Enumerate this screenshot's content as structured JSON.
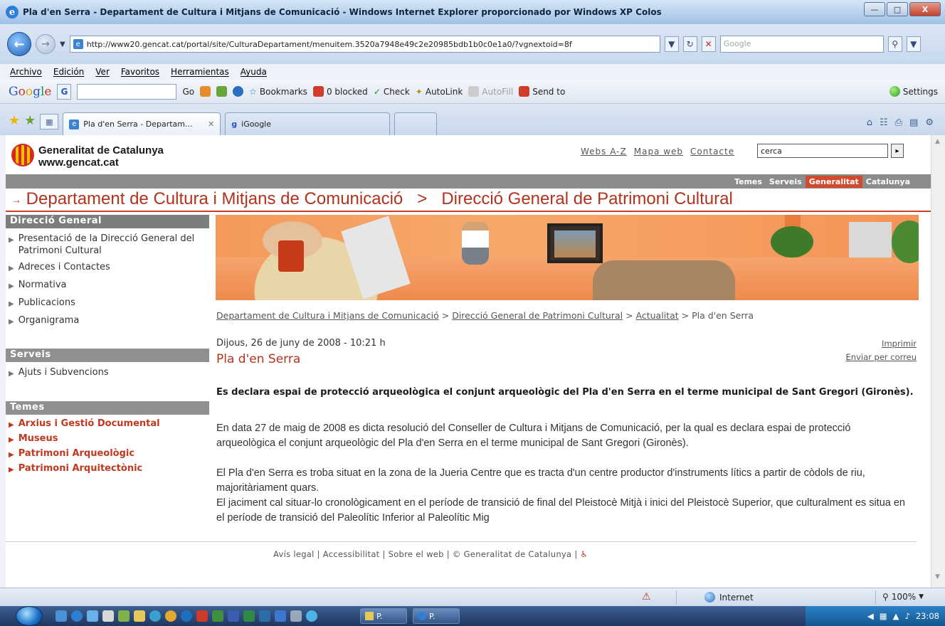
{
  "window": {
    "title": "Pla d'en Serra - Departament de Cultura i Mitjans de Comunicació - Windows Internet Explorer proporcionado por Windows XP Colos"
  },
  "address_bar": {
    "url": "http://www20.gencat.cat/portal/site/CulturaDepartament/menuitem.3520a7948e49c2e20985bdb1b0c0e1a0/?vgnextoid=8f",
    "search_placeholder": "Google"
  },
  "menu": [
    "Archivo",
    "Edición",
    "Ver",
    "Favoritos",
    "Herramientas",
    "Ayuda"
  ],
  "google_toolbar": {
    "go": "Go",
    "bookmarks": "Bookmarks",
    "blocked": "0 blocked",
    "check": "Check",
    "autolink": "AutoLink",
    "autofill": "AutoFill",
    "send_to": "Send to",
    "settings": "Settings"
  },
  "tabs": [
    {
      "label": "Pla d'en Serra - Departam..."
    },
    {
      "label": "iGoogle"
    }
  ],
  "site": {
    "org_name": "Generalitat de Catalunya",
    "org_url": "www.gencat.cat",
    "top_links": [
      "Webs A-Z",
      "Mapa web",
      "Contacte"
    ],
    "search_value": "cerca",
    "nav_tabs": [
      "Temes",
      "Serveis",
      "Generalitat",
      "Catalunya"
    ],
    "active_nav": "Generalitat",
    "dept_title": "Departament de Cultura i Mitjans de Comunicació",
    "dept_separator": ">",
    "sub_title": "Direcció General de Patrimoni Cultural"
  },
  "sidebar": {
    "section1": "Direcció General",
    "section1_items": [
      "Presentació de la Direcció General del Patrimoni Cultural",
      "Adreces i Contactes",
      "Normativa",
      "Publicacions",
      "Organigrama"
    ],
    "section2": "Serveis",
    "section2_items": [
      "Ajuts i Subvencions"
    ],
    "section3": "Temes",
    "section3_items": [
      "Arxius i Gestió Documental",
      "Museus",
      "Patrimoni Arqueològic",
      "Patrimoni Arquitectònic"
    ]
  },
  "breadcrumb": {
    "items": [
      "Departament de Cultura i Mitjans de Comunicació",
      "Direcció General de Patrimoni Cultural",
      "Actualitat"
    ],
    "current": "Pla d'en Serra",
    "separator": ">"
  },
  "article": {
    "date": "Dijous, 26 de juny de 2008 - 10:21 h",
    "title": "Pla d'en Serra",
    "print": "Imprimir",
    "email": "Enviar per correu",
    "lead": "Es declara espai de protecció arqueològica el conjunt arqueològic del Pla d'en Serra en el terme municipal de Sant Gregori (Gironès).",
    "p1": "En data 27 de maig de 2008 es dicta resolució del Conseller de Cultura i Mitjans de Comunicació, per la qual es declara espai de protecció arqueològica el conjunt arqueològic del Pla d'en Serra en el terme municipal de Sant Gregori (Gironès).",
    "p2": "El Pla d'en Serra es troba situat en la zona de la Jueria Centre que es tracta d'un centre productor d'instruments lítics a partir de còdols de riu, majoritàriament quars.",
    "p3": "El jaciment cal situar-lo cronològicament en el període de transició de final del Pleistocè Mitjà i inici del Pleistocè Superior, que culturalment es situa en el període de transició del Paleolític Inferior al Paleolític Mig"
  },
  "footer": {
    "items": [
      "Avís legal",
      "Accessibilitat",
      "Sobre el web",
      "© Generalitat de Catalunya"
    ],
    "separator": "|"
  },
  "status_bar": {
    "zone": "Internet",
    "zoom": "100%"
  },
  "taskbar": {
    "buttons": [
      "P.",
      "P."
    ],
    "clock": "23:08"
  },
  "colors": {
    "accent_red": "#b2331d",
    "nav_active": "#d24a2c",
    "section_grey": "#8f8f8f"
  }
}
